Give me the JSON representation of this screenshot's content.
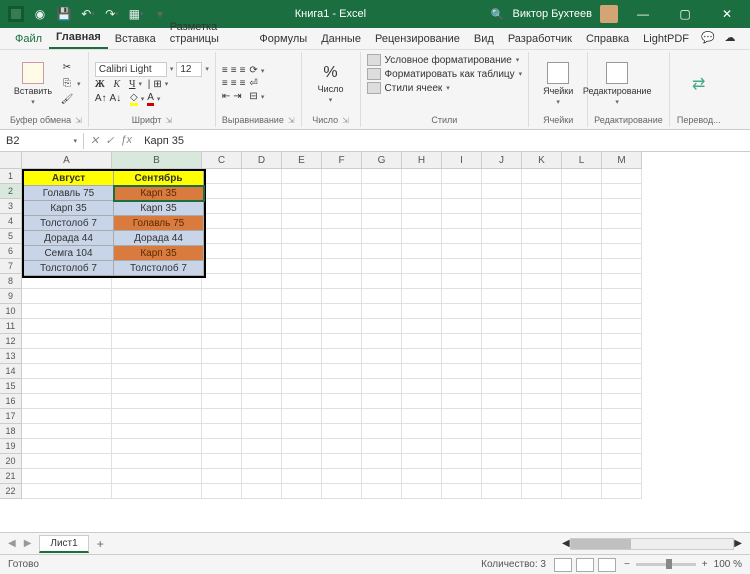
{
  "title": {
    "doc": "Книга1",
    "app": "Excel"
  },
  "user": "Виктор Бухтеев",
  "tabs": [
    "Файл",
    "Главная",
    "Вставка",
    "Разметка страницы",
    "Формулы",
    "Данные",
    "Рецензирование",
    "Вид",
    "Разработчик",
    "Справка",
    "LightPDF"
  ],
  "activeTab": 1,
  "ribbon": {
    "clipboard": {
      "label": "Буфер обмена",
      "paste": "Вставить"
    },
    "font": {
      "label": "Шрифт",
      "name": "Calibri Light",
      "size": "12"
    },
    "align": {
      "label": "Выравнивание"
    },
    "number": {
      "label": "Число"
    },
    "styles": {
      "label": "Стили",
      "cond": "Условное форматирование",
      "table": "Форматировать как таблицу",
      "cell": "Стили ячеек"
    },
    "cells": {
      "label": "Ячейки"
    },
    "editing": {
      "label": "Редактирование"
    },
    "translate": {
      "label": "Перевод..."
    }
  },
  "namebox": "B2",
  "formula": "Карп 35",
  "columns": [
    "A",
    "B",
    "C",
    "D",
    "E",
    "F",
    "G",
    "H",
    "I",
    "J",
    "K",
    "L",
    "M"
  ],
  "chart_data": {
    "type": "table",
    "headers": [
      "Август",
      "Сентябрь"
    ],
    "rows": [
      {
        "a": "Голавль 75",
        "b": "Карп 35",
        "astyle": "lblue",
        "bstyle": "orange"
      },
      {
        "a": "Карп 35",
        "b": "Карп 35",
        "astyle": "lblue",
        "bstyle": "lblue"
      },
      {
        "a": "Толстолоб 7",
        "b": "Голавль 75",
        "astyle": "lblue",
        "bstyle": "orange"
      },
      {
        "a": "Дорада 44",
        "b": "Дорада 44",
        "astyle": "lblue",
        "bstyle": "lblue"
      },
      {
        "a": "Семга 104",
        "b": "Карп 35",
        "astyle": "lblue",
        "bstyle": "orange"
      },
      {
        "a": "Толстолоб 7",
        "b": "Толстолоб 7",
        "astyle": "lblue",
        "bstyle": "lblue"
      }
    ]
  },
  "sheetTab": "Лист1",
  "status": {
    "ready": "Готово",
    "count": "Количество: 3",
    "zoom": "100 %"
  }
}
